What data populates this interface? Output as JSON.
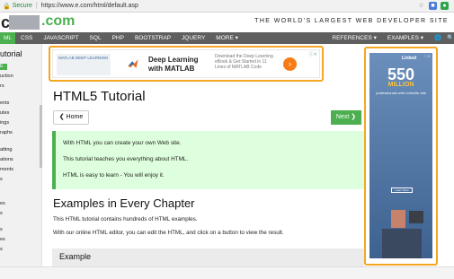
{
  "browser": {
    "secure_label": "Secure",
    "url": "https://www.e.com/html/default.asp"
  },
  "header": {
    "logo_letter": "c",
    "logo_suffix": ".com",
    "tagline": "THE WORLD'S LARGEST WEB DEVELOPER SITE"
  },
  "nav": {
    "items": [
      "ML",
      "CSS",
      "JAVASCRIPT",
      "SQL",
      "PHP",
      "BOOTSTRAP",
      "JQUERY",
      "MORE ▾"
    ],
    "references": "REFERENCES ▾",
    "examples": "EXAMPLES ▾",
    "globe_icon": "globe-icon",
    "search_icon": "search-icon",
    "accent": "#4caf50",
    "bar_color": "#5f5f5f"
  },
  "sidebar": {
    "title": "utorial",
    "items": [
      "E",
      "uction",
      "rs",
      "ents",
      "utes",
      "ings",
      "raphs",
      "",
      "atting",
      "ations",
      "ments",
      "s",
      "",
      "es",
      "s",
      "",
      "s",
      "es",
      "s"
    ]
  },
  "ad_top": {
    "thumb_text": "MATLAB DEEP LEARNING",
    "headline_line1": "Deep Learning",
    "headline_line2": "with MATLAB",
    "description": "Download the Deep Learning eBook & Get Started in 11 Lines of MATLAB Code",
    "cta_icon": "arrow-right-icon",
    "close_label": "ⓘ✕"
  },
  "main": {
    "title": "HTML5 Tutorial",
    "home_button": "❮ Home",
    "next_button": "Next ❯",
    "note_lines": [
      "With HTML you can create your own Web site.",
      "This tutorial teaches you everything about HTML.",
      "HTML is easy to learn - You will enjoy it."
    ],
    "section_title": "Examples in Every Chapter",
    "paragraphs": [
      "This HTML tutorial contains hundreds of HTML examples.",
      "With our online HTML editor, you can edit the HTML, and click on a button to view the result."
    ],
    "example_heading": "Example"
  },
  "ad_right": {
    "brand": "Linked",
    "big_number": "550",
    "million": "MILLION",
    "desc": "professionals with LinkedIn ads",
    "button": "Learn More",
    "close_label": "ⓘ✕"
  }
}
